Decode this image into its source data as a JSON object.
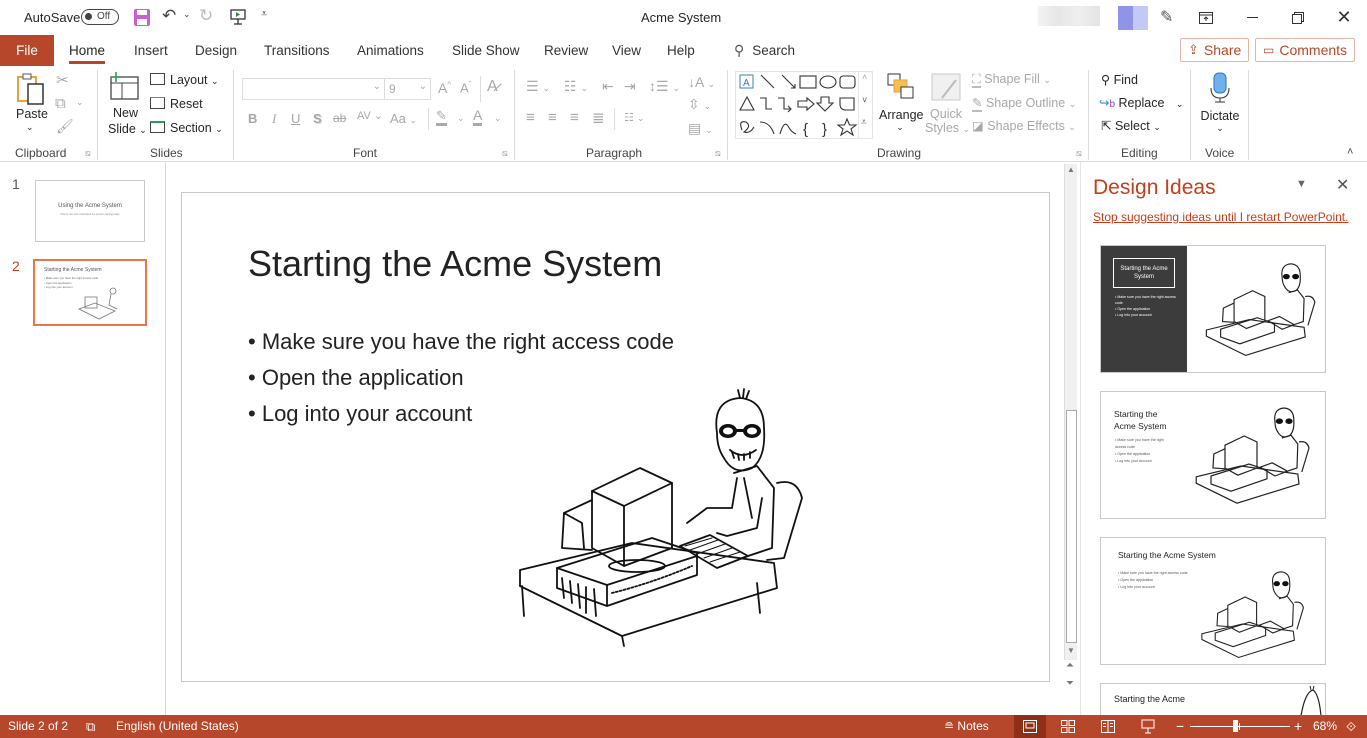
{
  "titlebar": {
    "autosave_label": "AutoSave",
    "autosave_state": "Off",
    "title": "Acme System",
    "icons": [
      "save-icon",
      "undo-icon",
      "redo-icon",
      "present-from-start-icon",
      "customize-qat-icon"
    ],
    "window_buttons": [
      "ribbon-display-options",
      "minimize",
      "restore",
      "close"
    ]
  },
  "tabs": {
    "items": [
      "File",
      "Home",
      "Insert",
      "Design",
      "Transitions",
      "Animations",
      "Slide Show",
      "Review",
      "View",
      "Help"
    ],
    "active": "Home",
    "search_label": "Search",
    "share_label": "Share",
    "comments_label": "Comments"
  },
  "ribbon": {
    "clipboard": {
      "label": "Clipboard",
      "paste": "Paste"
    },
    "slides": {
      "label": "Slides",
      "new_slide_1": "New",
      "new_slide_2": "Slide",
      "layout": "Layout",
      "reset": "Reset",
      "section": "Section"
    },
    "font": {
      "label": "Font",
      "font_name": "",
      "font_size": "9",
      "bold": "B",
      "italic": "I",
      "underline": "U",
      "shadow": "S",
      "strike": "ab",
      "spacing": "AV",
      "case": "Aa",
      "grow": "A",
      "shrink": "A",
      "color": "A"
    },
    "paragraph": {
      "label": "Paragraph"
    },
    "drawing": {
      "label": "Drawing",
      "arrange": "Arrange",
      "quick_styles_1": "Quick",
      "quick_styles_2": "Styles",
      "shape_fill": "Shape Fill",
      "shape_outline": "Shape Outline",
      "shape_effects": "Shape Effects"
    },
    "editing": {
      "label": "Editing",
      "find": "Find",
      "replace": "Replace",
      "select": "Select"
    },
    "voice": {
      "label": "Voice",
      "dictate": "Dictate"
    }
  },
  "thumbnails": [
    {
      "number": "1",
      "title": "Using the Acme System",
      "subtitle": "How to use and understand the system starting today",
      "selected": false
    },
    {
      "number": "2",
      "title": "Starting the Acme System",
      "bullets": [
        "Make sure you have the right access code",
        "Open the application",
        "Log into your account"
      ],
      "selected": true
    }
  ],
  "slide": {
    "title": "Starting the Acme System",
    "bullets": [
      "Make sure you have the right access code",
      "Open the application",
      "Log into your account"
    ],
    "image": "cartoon-man-at-computer"
  },
  "design_ideas": {
    "title": "Design Ideas",
    "stop_link": "Stop suggesting ideas until I restart PowerPoint.",
    "ideas": [
      {
        "title": "Starting the Acme System",
        "bullets": [
          "Make sure you have the right access code",
          "Open the application",
          "Log into your account"
        ],
        "style": "dark-left-panel"
      },
      {
        "title_line1": "Starting the",
        "title_line2": "Acme System",
        "bullets": [
          "Make sure you have the right access code",
          "Open the application",
          "Log into your account"
        ],
        "style": "two-line-title"
      },
      {
        "title": "Starting the Acme System",
        "bullets": [
          "Make sure you have the right access code",
          "Open the application",
          "Log into your account"
        ],
        "style": "wide-title"
      },
      {
        "title": "Starting the Acme",
        "style": "partial"
      }
    ]
  },
  "statusbar": {
    "slide_info": "Slide 2 of 2",
    "language": "English (United States)",
    "notes": "Notes",
    "zoom": "68%",
    "zoom_minus": "−",
    "zoom_plus": "+",
    "zoom_level_fraction": 0.45
  },
  "colors": {
    "accent": "#b7472a",
    "selected_thumb": "#e97548",
    "link": "#c43e1c"
  }
}
